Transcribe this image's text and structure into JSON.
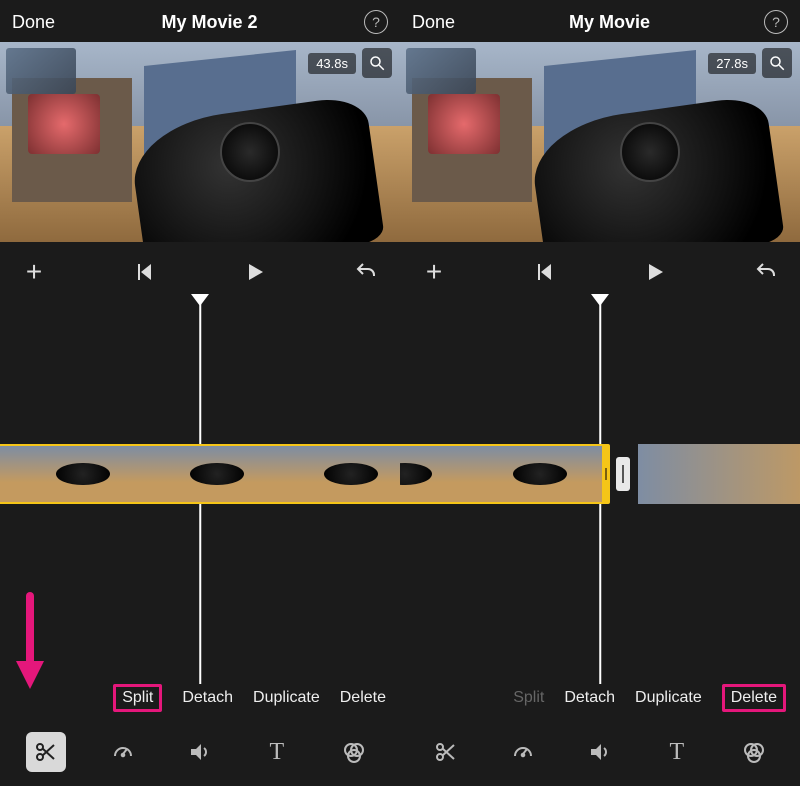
{
  "panels": [
    {
      "header": {
        "done": "Done",
        "title": "My Movie 2"
      },
      "preview": {
        "time": "43.8s"
      },
      "actions": {
        "split": "Split",
        "detach": "Detach",
        "duplicate": "Duplicate",
        "delete": "Delete",
        "split_dim": false,
        "highlight": "split"
      },
      "tool_selected": true,
      "show_arrow": true
    },
    {
      "header": {
        "done": "Done",
        "title": "My Movie"
      },
      "preview": {
        "time": "27.8s"
      },
      "actions": {
        "split": "Split",
        "detach": "Detach",
        "duplicate": "Duplicate",
        "delete": "Delete",
        "split_dim": true,
        "highlight": "delete"
      },
      "tool_selected": false,
      "show_arrow": false
    }
  ],
  "icons": {
    "help": "help-circle-icon",
    "magnify": "magnify-icon",
    "plus": "plus-icon",
    "skip_back": "skip-back-icon",
    "play": "play-icon",
    "undo": "undo-icon",
    "scissors": "scissors-icon",
    "speed": "speedometer-icon",
    "volume": "volume-icon",
    "text": "text-icon",
    "filters": "filters-icon"
  },
  "colors": {
    "highlight": "#e5177b",
    "clip_border": "#f5c518"
  }
}
